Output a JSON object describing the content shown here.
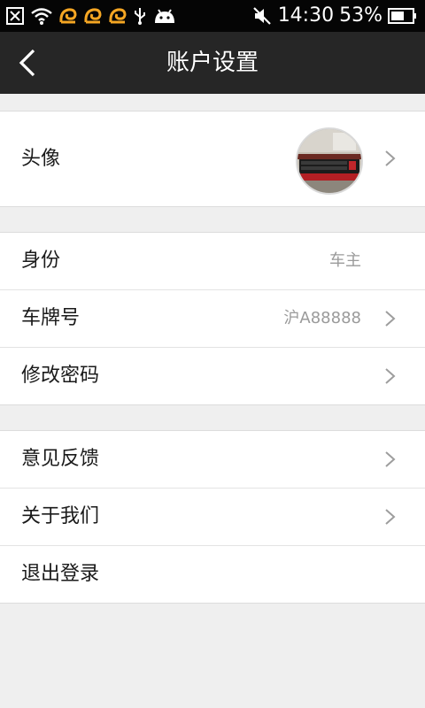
{
  "status_bar": {
    "time": "14:30",
    "battery_percent": "53%",
    "icons": [
      "close-notification-icon",
      "wifi-icon",
      "app-notification-icon",
      "app-notification-icon",
      "app-notification-icon",
      "usb-icon",
      "android-icon",
      "mute-icon",
      "battery-icon"
    ]
  },
  "header": {
    "title": "账户设置",
    "back_icon": "chevron-left-icon"
  },
  "groups": {
    "profile": {
      "avatar_label": "头像"
    },
    "account": {
      "identity_label": "身份",
      "identity_value": "车主",
      "plate_label": "车牌号",
      "plate_value": "沪A88888",
      "password_label": "修改密码"
    },
    "other": {
      "feedback_label": "意见反馈",
      "about_label": "关于我们",
      "logout_label": "退出登录"
    }
  },
  "colors": {
    "status_bar_bg": "#050505",
    "header_bg": "#262626",
    "page_bg": "#efefef",
    "value_text": "#9a9a9a"
  }
}
